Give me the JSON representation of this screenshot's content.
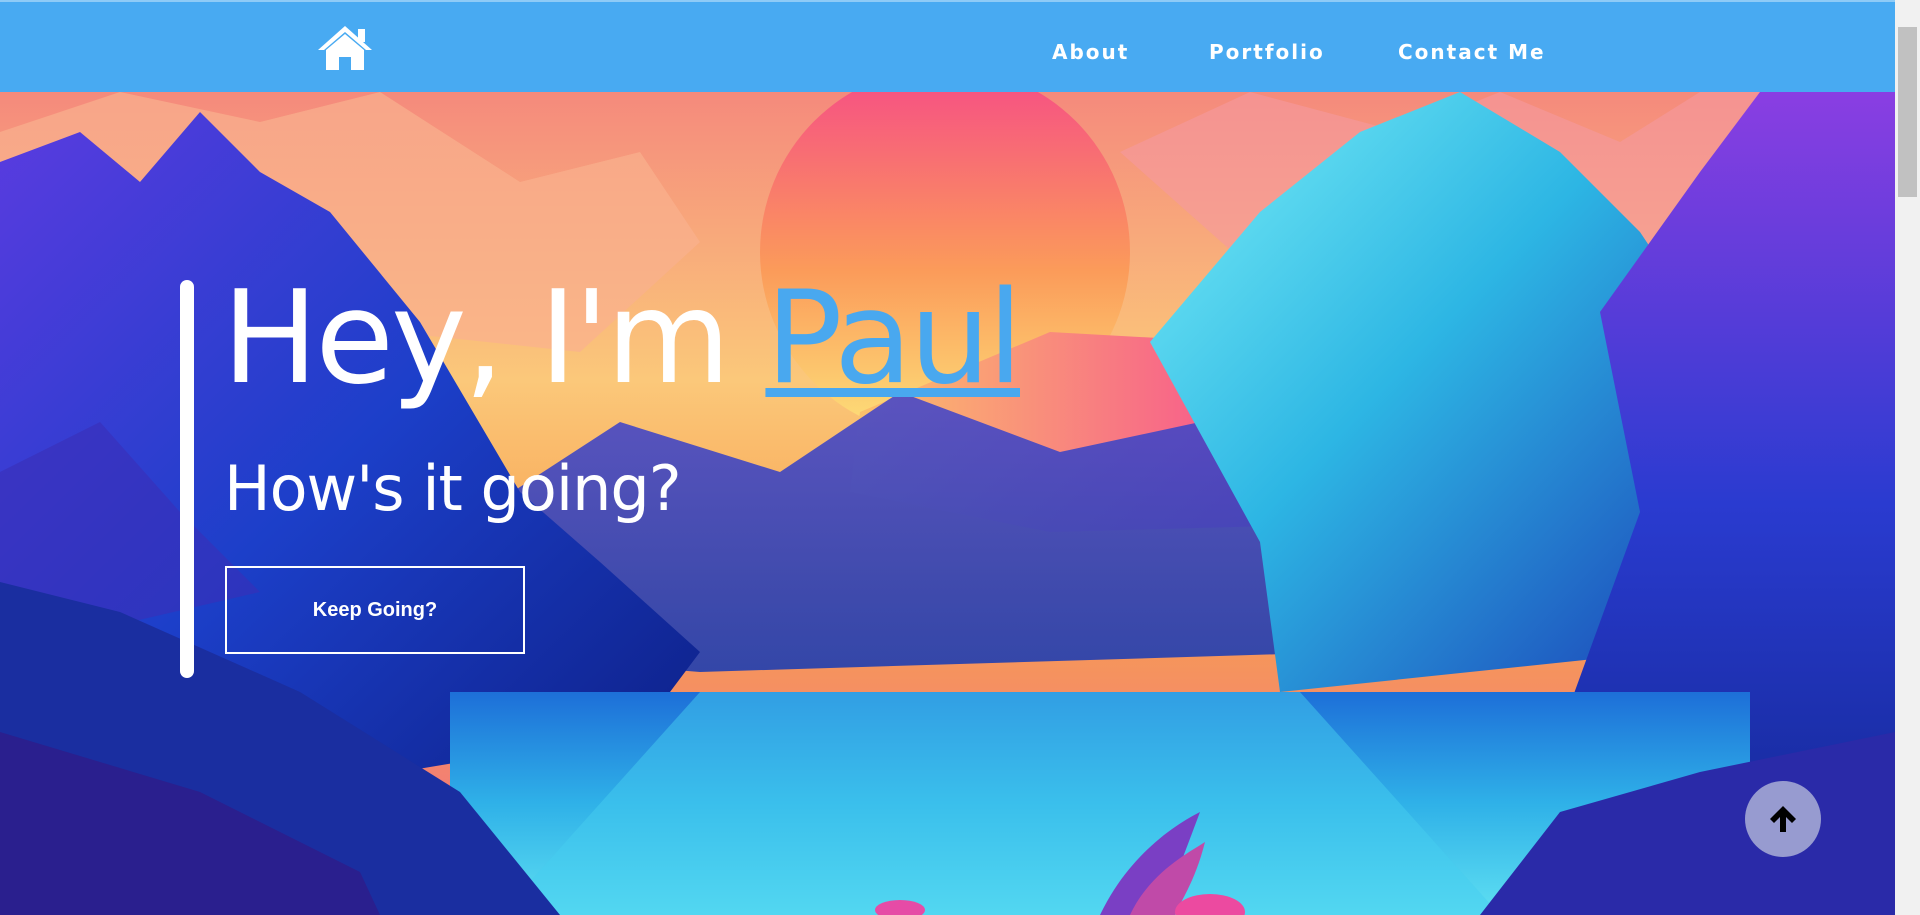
{
  "nav": {
    "home_icon": "home-icon",
    "links": [
      {
        "label": "About"
      },
      {
        "label": "Portfolio"
      },
      {
        "label": "Contact Me"
      }
    ],
    "bg_color": "#48aaf2"
  },
  "hero": {
    "title_prefix": "Hey, I'm ",
    "name": "Paul",
    "subtitle": "How's it going?",
    "button_label": "Keep Going?",
    "accent_color": "#49a8ef"
  },
  "scroll_top": {
    "icon": "arrow-up-icon"
  }
}
